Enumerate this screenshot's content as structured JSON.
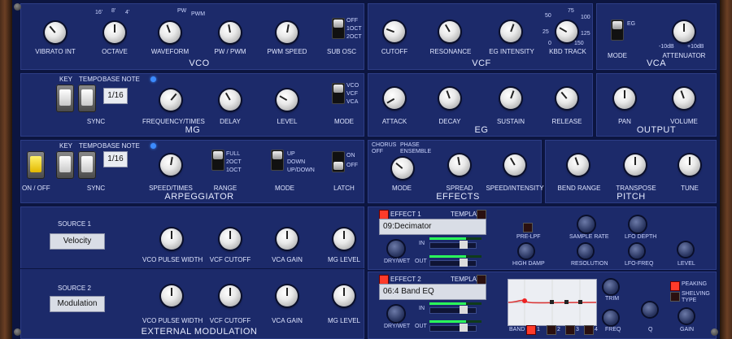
{
  "vco": {
    "title": "VCO",
    "knobs": [
      "VIBRATO INT",
      "OCTAVE",
      "WAVEFORM",
      "PW / PWM",
      "PWM SPEED"
    ],
    "octave_ticks": [
      "16'",
      "8'",
      "4'"
    ],
    "waveform_ticks": [
      "PW",
      "PWM"
    ],
    "sub_osc_label": "SUB OSC",
    "sub_osc_opts": [
      "OFF",
      "1OCT",
      "2OCT"
    ]
  },
  "vcf": {
    "title": "VCF",
    "knobs": [
      "CUTOFF",
      "RESONANCE",
      "EG INTENSITY",
      "KBD TRACK"
    ],
    "kbd_ticks": [
      "50",
      "75",
      "100",
      "25",
      "125",
      "0",
      "150"
    ]
  },
  "vca": {
    "title": "VCA",
    "mode_label": "MODE",
    "mode_opt": "EG",
    "attenuator_label": "ATTENUATOR",
    "att_ticks": [
      "-10dB",
      "+10dB"
    ]
  },
  "mg": {
    "title": "MG",
    "key": "KEY",
    "tempo": "TEMPO",
    "base_note": "BASE NOTE",
    "base_value": "1/16",
    "sync": "SYNC",
    "knobs": [
      "FREQUENCY/TIMES",
      "DELAY",
      "LEVEL"
    ],
    "mode_label": "MODE",
    "mode_opts": [
      "VCO",
      "VCF",
      "VCA"
    ]
  },
  "eg": {
    "title": "EG",
    "knobs": [
      "ATTACK",
      "DECAY",
      "SUSTAIN",
      "RELEASE"
    ]
  },
  "output": {
    "title": "OUTPUT",
    "knobs": [
      "PAN",
      "VOLUME"
    ]
  },
  "arp": {
    "title": "ARPEGGIATOR",
    "onoff": "ON / OFF",
    "key": "KEY",
    "tempo": "TEMPO",
    "base_note": "BASE NOTE",
    "base_value": "1/16",
    "sync": "SYNC",
    "speed": "SPEED/TIMES",
    "range_label": "RANGE",
    "range_opts": [
      "FULL",
      "2OCT",
      "1OCT"
    ],
    "mode_label": "MODE",
    "mode_opts": [
      "UP",
      "DOWN",
      "UP/DOWN"
    ],
    "latch_label": "LATCH",
    "latch_opts": [
      "ON",
      "OFF"
    ]
  },
  "effects": {
    "title": "EFFECTS",
    "mode_ticks": [
      "CHORUS",
      "PHASE",
      "OFF",
      "ENSEMBLE"
    ],
    "knobs": [
      "MODE",
      "SPREAD",
      "SPEED/INTENSITY"
    ]
  },
  "pitch": {
    "title": "PITCH",
    "knobs": [
      "BEND RANGE",
      "TRANSPOSE",
      "TUNE"
    ]
  },
  "extmod": {
    "title": "EXTERNAL MODULATION",
    "source1_label": "SOURCE 1",
    "source1_value": "Velocity",
    "source2_label": "SOURCE 2",
    "source2_value": "Modulation",
    "knobs": [
      "VCO PULSE WIDTH",
      "VCF CUTOFF",
      "VCA GAIN",
      "MG LEVEL"
    ]
  },
  "fx1": {
    "label": "EFFECT 1",
    "template": "TEMPLATE",
    "preset": "09:Decimator",
    "drywet": "DRY/WET",
    "in": "IN",
    "out": "OUT",
    "prelpf": "PRE-LPF",
    "highdamp": "HIGH DAMP",
    "samplerate": "SAMPLE RATE",
    "resolution": "RESOLUTION",
    "lfodepth": "LFO DEPTH",
    "lfofreq": "LFO-FREQ",
    "level": "LEVEL"
  },
  "fx2": {
    "label": "EFFECT 2",
    "template": "TEMPLATE",
    "preset": "06:4 Band EQ",
    "drywet": "DRY/WET",
    "in": "IN",
    "out": "OUT",
    "band": "BAND",
    "bands": [
      "1",
      "2",
      "3",
      "4"
    ],
    "trim": "TRIM",
    "freq": "FREQ",
    "q": "Q",
    "gain": "GAIN",
    "peaking": "PEAKING",
    "shelving": "SHELVING TYPE"
  }
}
